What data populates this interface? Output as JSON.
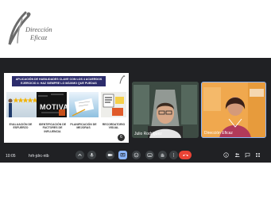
{
  "brand": {
    "line1": "Dirección",
    "line2": "Eficaz"
  },
  "slide": {
    "title": "APLICACIÓN DE HABILIDADES CLAVE CON LOS 4 ACUERDOS EJERCICIO 4: HAZ SIEMPRE LO MÁXIMO QUE PUEDAS",
    "motivate_text": "MOTIVATE",
    "labels": [
      "EVALUACIÓN DE ESFUERZO",
      "IDENTIFICACIÓN DE FACTORES DE INFLUENCIA",
      "PLANIFICACIÓN DE MEJORAS",
      "RECORDATORIO VISUAL"
    ],
    "page_number": "6"
  },
  "participants": [
    {
      "name": "Julio Rodríguez"
    },
    {
      "name": "Dirección Eficaz"
    }
  ],
  "meeting": {
    "time": "10:05",
    "code": "hrh-jdrc-ntb"
  },
  "colors": {
    "meet_bg": "#202124",
    "end_call": "#ea4335",
    "present_active": "#8ab4f8"
  }
}
